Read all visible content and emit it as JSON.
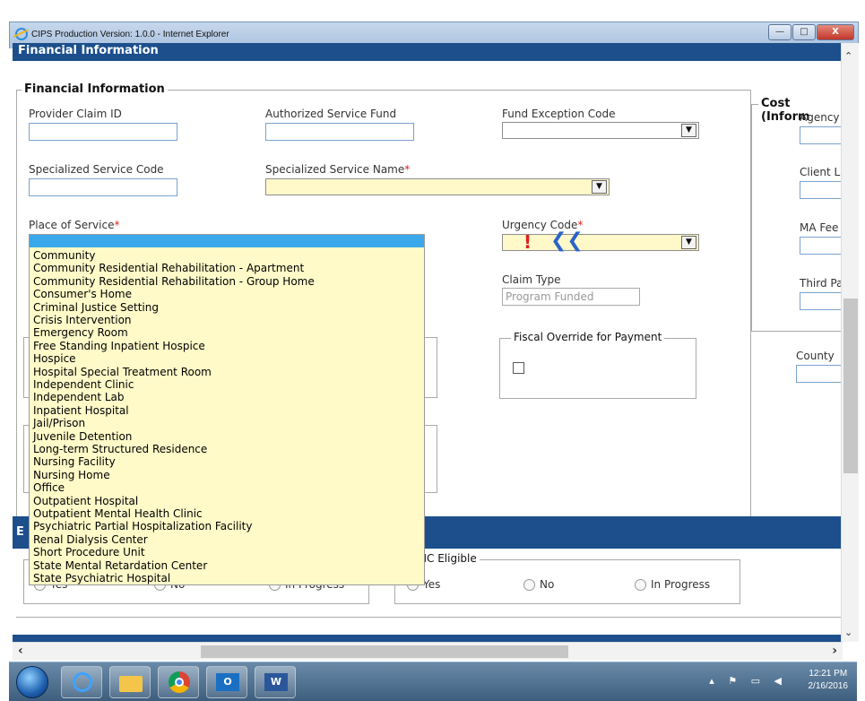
{
  "window": {
    "title": "CIPS Production Version: 1.0.0 - Internet Explorer",
    "minimize": "—",
    "maximize": "□",
    "close": "X"
  },
  "header": {
    "title": "Financial Information"
  },
  "financial": {
    "legend": "Financial Information",
    "provider_claim_id": "Provider Claim ID",
    "authorized_service_fund": "Authorized Service Fund",
    "fund_exception_code": "Fund Exception Code",
    "specialized_service_code": "Specialized Service Code",
    "specialized_service_name": "Specialized Service Name",
    "place_of_service": "Place of Service",
    "urgency_code": "Urgency Code",
    "claim_type": "Claim Type",
    "claim_type_value": "Program Funded",
    "required_mark": "*"
  },
  "cost": {
    "legend": "Cost (Inform",
    "agency": "Agency",
    "client": "Client L",
    "ma_fee": "MA Fee",
    "third_party": "Third Pa",
    "county": "County"
  },
  "fiscal_override": {
    "legend": "Fiscal Override for Payment"
  },
  "hc_eligible": {
    "legend": "HC Eligible",
    "options": [
      "Yes",
      "No",
      "In Progress"
    ]
  },
  "left_radio_group": {
    "options": [
      "Yes",
      "No",
      "In Progress"
    ]
  },
  "bottom_section_letter": "E",
  "place_of_service_options": [
    "Community",
    "Community Residential Rehabilitation - Apartment",
    "Community Residential Rehabilitation - Group Home",
    "Consumer's Home",
    "Criminal Justice Setting",
    "Crisis Intervention",
    "Emergency Room",
    "Free Standing Inpatient Hospice",
    "Hospice",
    "Hospital Special Treatment Room",
    "Independent Clinic",
    "Independent Lab",
    "Inpatient Hospital",
    "Jail/Prison",
    "Juvenile Detention",
    "Long-term Structured Residence",
    "Nursing Facility",
    "Nursing Home",
    "Office",
    "Outpatient Hospital",
    "Outpatient Mental Health Clinic",
    "Psychiatric Partial Hospitalization Facility",
    "Renal Dialysis Center",
    "Short Procedure Unit",
    "State Mental Retardation Center",
    "State Psychiatric Hospital"
  ],
  "annotation": {
    "exclaim": "!",
    "arrows": "❮❮"
  },
  "taskbar": {
    "time": "12:21 PM",
    "date": "2/16/2016",
    "apps": [
      "internet-explorer",
      "file-explorer",
      "chrome",
      "outlook",
      "word"
    ]
  },
  "colors": {
    "header_blue": "#1c4f8c",
    "required_red": "#e02020",
    "selection_blue": "#3aa8ea",
    "dropdown_bg": "#fffac8"
  }
}
